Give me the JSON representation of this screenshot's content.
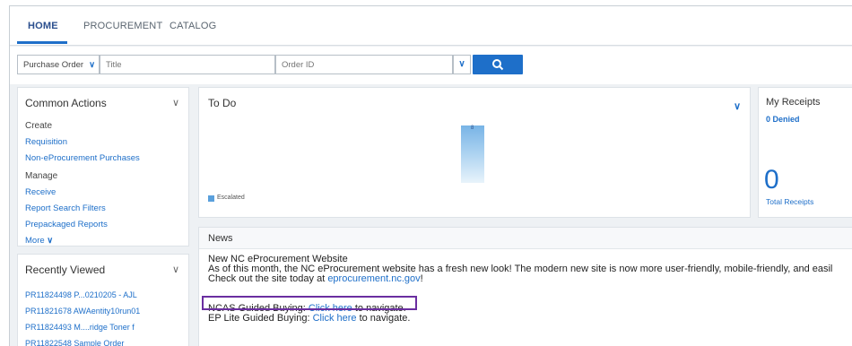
{
  "tabs": [
    {
      "label": "HOME",
      "active": true
    },
    {
      "label": "PROCUREMENT",
      "active": false
    },
    {
      "label": "CATALOG",
      "active": false
    }
  ],
  "search": {
    "type_value": "Purchase Order",
    "title_placeholder": "Title",
    "order_placeholder": "Order ID"
  },
  "common_actions": {
    "title": "Common Actions",
    "create_header": "Create",
    "create_items": [
      "Requisition",
      "Non-eProcurement Purchases"
    ],
    "manage_header": "Manage",
    "manage_items": [
      "Receive",
      "Report Search Filters",
      "Prepackaged Reports"
    ],
    "more_label": "More"
  },
  "todo": {
    "title": "To Do",
    "bar_label": "8",
    "chart_data": {
      "type": "bar",
      "categories": [
        ""
      ],
      "series": [
        {
          "name": "Escalated",
          "values": [
            8
          ]
        }
      ]
    },
    "legend_label": "Escalated"
  },
  "receipts": {
    "title": "My Receipts",
    "denied_label": "0 Denied",
    "total_value": "0",
    "total_label": "Total Receipts"
  },
  "recently_viewed": {
    "title": "Recently Viewed",
    "items": [
      "PR11824498 P...0210205 - AJL",
      "PR11821678 AWAentity10run01",
      "PR11824493 M....ridge Toner f",
      "PR11822548 Sample Order"
    ]
  },
  "news": {
    "title": "News",
    "headline": "New NC eProcurement Website",
    "line1": "As of this month, the NC eProcurement website has a fresh new look! The modern new site is now more user-friendly, mobile-friendly, and easil",
    "line2_prefix": "Check out the site today at ",
    "line2_link": "eprocurement.nc.gov",
    "line2_suffix": "!",
    "ncas_prefix": "NCAS Guided Buying: ",
    "ncas_link": "Click here",
    "ncas_suffix": " to navigate.",
    "ep_prefix": "EP Lite Guided Buying: ",
    "ep_link": "Click here",
    "ep_suffix": " to navigate."
  },
  "colors": {
    "accent": "#1e6fc9",
    "highlight_box": "#6a2ea0"
  }
}
